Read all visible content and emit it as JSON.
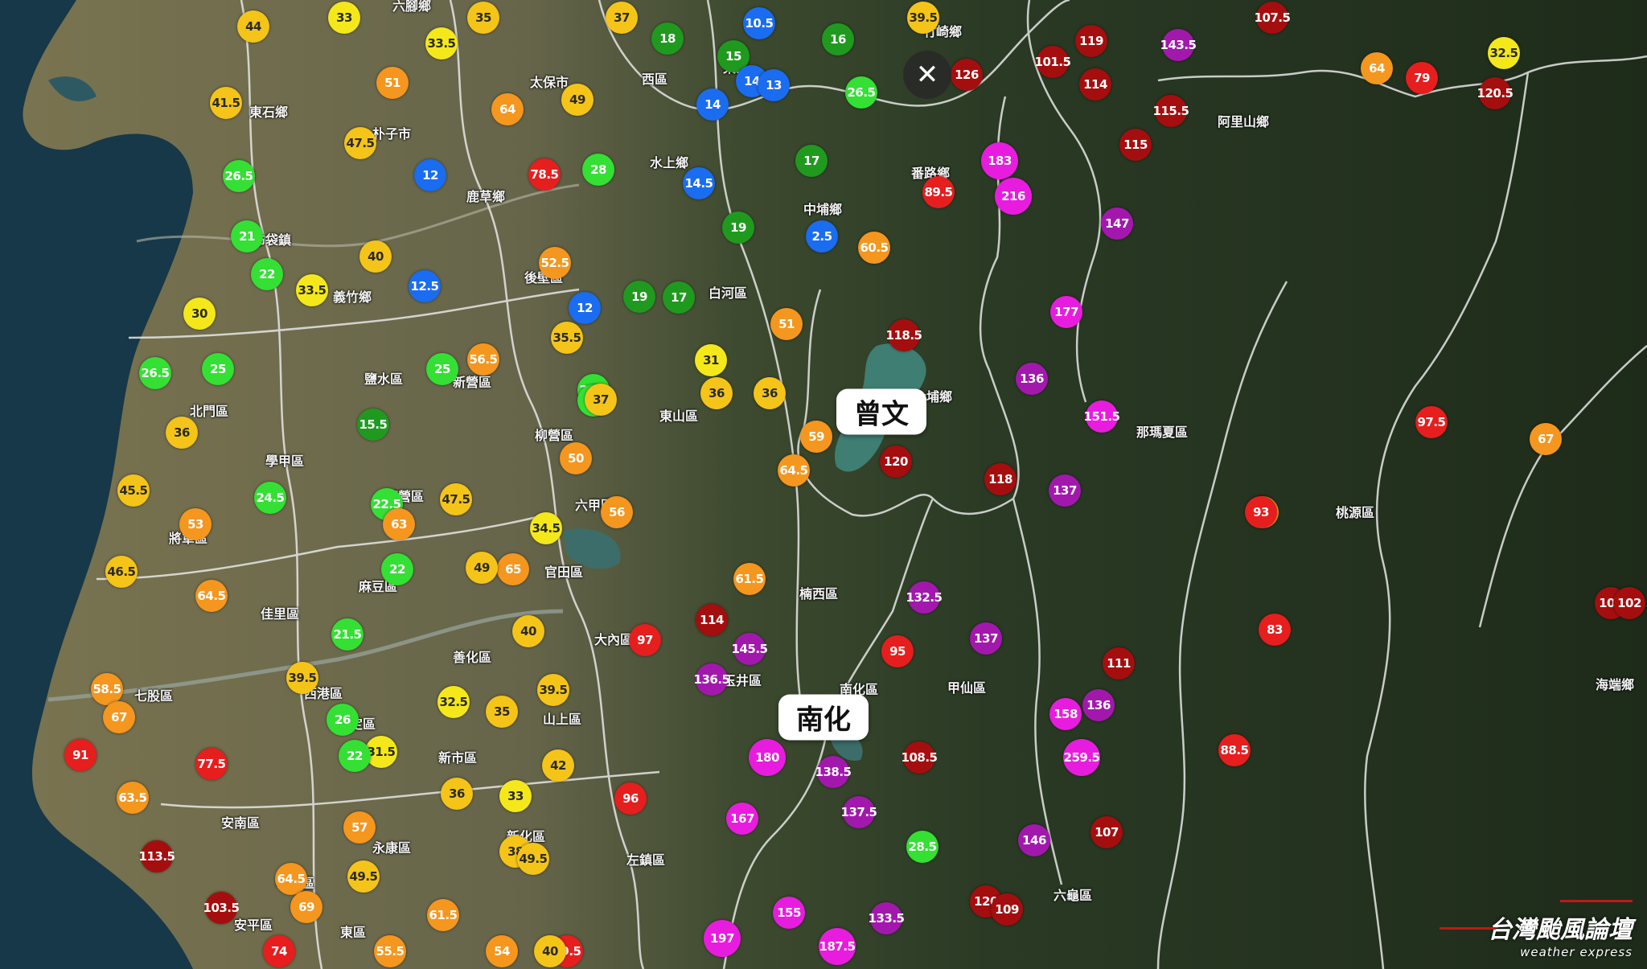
{
  "colors": {
    "sea": "#163848",
    "plain": "#6e6a4a",
    "mountain": "#26361f",
    "reservoir": "#3f7e72",
    "boundary": "#e6e6e6",
    "rain_blue": "#1a6cf0",
    "rain_green_dark": "#1f9a1f",
    "rain_green": "#33e033",
    "rain_yellow": "#f5e81a",
    "rain_yellow_orange": "#f5c418",
    "rain_orange": "#f5961e",
    "rain_red": "#e61e1e",
    "rain_darkred": "#a50e0e",
    "rain_purple": "#a218ad",
    "rain_magenta": "#e81cde"
  },
  "close_button": {
    "icon": "close-icon",
    "glyph": "✕"
  },
  "callouts": [
    {
      "label": "曾文"
    },
    {
      "label": "南化"
    }
  ],
  "places": [
    "六腳鄉",
    "竹崎鄉",
    "太保市",
    "西區",
    "東區",
    "東石鄉",
    "朴子市",
    "水上鄉",
    "鹿草鄉",
    "番路鄉",
    "中埔鄉",
    "阿里山鄉",
    "布袋鎮",
    "義竹鄉",
    "後壁區",
    "白河區",
    "鹽水區",
    "新營區",
    "北門區",
    "大埔鄉",
    "東山區",
    "柳營區",
    "那瑪夏區",
    "學甲區",
    "下營區",
    "將軍區",
    "六甲區",
    "官田區",
    "楠西區",
    "桃源區",
    "麻豆區",
    "佳里區",
    "大內區",
    "玉井區",
    "善化區",
    "西港區",
    "南化區",
    "甲仙區",
    "海端鄉",
    "七股區",
    "安定區",
    "山上區",
    "新市區",
    "安南區",
    "永康區",
    "新化區",
    "左鎮區",
    "中西區",
    "安平區",
    "東區",
    "六龜區"
  ],
  "rainfall_markers": [
    {
      "value": "33"
    },
    {
      "value": "35"
    },
    {
      "value": "37"
    },
    {
      "value": "39.5"
    },
    {
      "value": "107.5"
    },
    {
      "value": "44"
    },
    {
      "value": "33.5"
    },
    {
      "value": "18"
    },
    {
      "value": "10.5"
    },
    {
      "value": "16"
    },
    {
      "value": "119"
    },
    {
      "value": "143.5"
    },
    {
      "value": "32.5"
    },
    {
      "value": "15"
    },
    {
      "value": "101.5"
    },
    {
      "value": "126"
    },
    {
      "value": "64"
    },
    {
      "value": "79"
    },
    {
      "value": "120.5"
    },
    {
      "value": "51"
    },
    {
      "value": "14"
    },
    {
      "value": "13"
    },
    {
      "value": "26.5"
    },
    {
      "value": "114"
    },
    {
      "value": "41.5"
    },
    {
      "value": "64"
    },
    {
      "value": "49"
    },
    {
      "value": "14"
    },
    {
      "value": "115.5"
    },
    {
      "value": "47.5"
    },
    {
      "value": "115"
    },
    {
      "value": "12"
    },
    {
      "value": "78.5"
    },
    {
      "value": "28"
    },
    {
      "value": "17"
    },
    {
      "value": "183"
    },
    {
      "value": "26.5"
    },
    {
      "value": "14.5"
    },
    {
      "value": "89.5"
    },
    {
      "value": "216"
    },
    {
      "value": "147"
    },
    {
      "value": "21"
    },
    {
      "value": "19"
    },
    {
      "value": "2.5"
    },
    {
      "value": "40"
    },
    {
      "value": "52.5"
    },
    {
      "value": "60.5"
    },
    {
      "value": "22"
    },
    {
      "value": "33.5"
    },
    {
      "value": "12.5"
    },
    {
      "value": "19"
    },
    {
      "value": "17"
    },
    {
      "value": "177"
    },
    {
      "value": "30"
    },
    {
      "value": "12"
    },
    {
      "value": "51"
    },
    {
      "value": "35.5"
    },
    {
      "value": "118.5"
    },
    {
      "value": "26.5"
    },
    {
      "value": "25"
    },
    {
      "value": "25"
    },
    {
      "value": "56.5"
    },
    {
      "value": "31"
    },
    {
      "value": "136"
    },
    {
      "value": "25.5"
    },
    {
      "value": "25"
    },
    {
      "value": "37"
    },
    {
      "value": "36"
    },
    {
      "value": "151.5"
    },
    {
      "value": "36"
    },
    {
      "value": "15.5"
    },
    {
      "value": "36"
    },
    {
      "value": "59"
    },
    {
      "value": "97.5"
    },
    {
      "value": "67"
    },
    {
      "value": "50"
    },
    {
      "value": "120"
    },
    {
      "value": "45.5"
    },
    {
      "value": "24.5"
    },
    {
      "value": "64.5"
    },
    {
      "value": "118"
    },
    {
      "value": "137"
    },
    {
      "value": "67"
    },
    {
      "value": "22.5"
    },
    {
      "value": "47.5"
    },
    {
      "value": "53"
    },
    {
      "value": "34.5"
    },
    {
      "value": "56"
    },
    {
      "value": "93"
    },
    {
      "value": "63"
    },
    {
      "value": "22"
    },
    {
      "value": "65"
    },
    {
      "value": "46.5"
    },
    {
      "value": "61.5"
    },
    {
      "value": "107"
    },
    {
      "value": "64.5"
    },
    {
      "value": "49"
    },
    {
      "value": "132.5"
    },
    {
      "value": "102"
    },
    {
      "value": "114"
    },
    {
      "value": "40"
    },
    {
      "value": "21.5"
    },
    {
      "value": "97"
    },
    {
      "value": "145.5"
    },
    {
      "value": "137"
    },
    {
      "value": "83"
    },
    {
      "value": "95"
    },
    {
      "value": "111"
    },
    {
      "value": "136.5"
    },
    {
      "value": "58.5"
    },
    {
      "value": "39.5"
    },
    {
      "value": "39.5"
    },
    {
      "value": "136"
    },
    {
      "value": "67"
    },
    {
      "value": "158"
    },
    {
      "value": "32.5"
    },
    {
      "value": "35"
    },
    {
      "value": "26"
    },
    {
      "value": "31.5"
    },
    {
      "value": "22"
    },
    {
      "value": "180"
    },
    {
      "value": "108.5"
    },
    {
      "value": "259.5"
    },
    {
      "value": "88.5"
    },
    {
      "value": "91"
    },
    {
      "value": "77.5"
    },
    {
      "value": "42"
    },
    {
      "value": "138.5"
    },
    {
      "value": "36"
    },
    {
      "value": "33"
    },
    {
      "value": "96"
    },
    {
      "value": "63.5"
    },
    {
      "value": "137.5"
    },
    {
      "value": "167"
    },
    {
      "value": "146"
    },
    {
      "value": "107"
    },
    {
      "value": "57"
    },
    {
      "value": "113.5"
    },
    {
      "value": "38"
    },
    {
      "value": "49.5"
    },
    {
      "value": "28.5"
    },
    {
      "value": "64.5"
    },
    {
      "value": "49.5"
    },
    {
      "value": "69"
    },
    {
      "value": "103.5"
    },
    {
      "value": "61.5"
    },
    {
      "value": "120"
    },
    {
      "value": "109"
    },
    {
      "value": "155"
    },
    {
      "value": "133.5"
    },
    {
      "value": "197"
    },
    {
      "value": "187.5"
    },
    {
      "value": "55.5"
    },
    {
      "value": "74"
    },
    {
      "value": "54"
    },
    {
      "value": "79.5"
    },
    {
      "value": "40"
    }
  ],
  "watermark": {
    "title": "台灣颱風論壇",
    "subtitle": "weather express"
  }
}
